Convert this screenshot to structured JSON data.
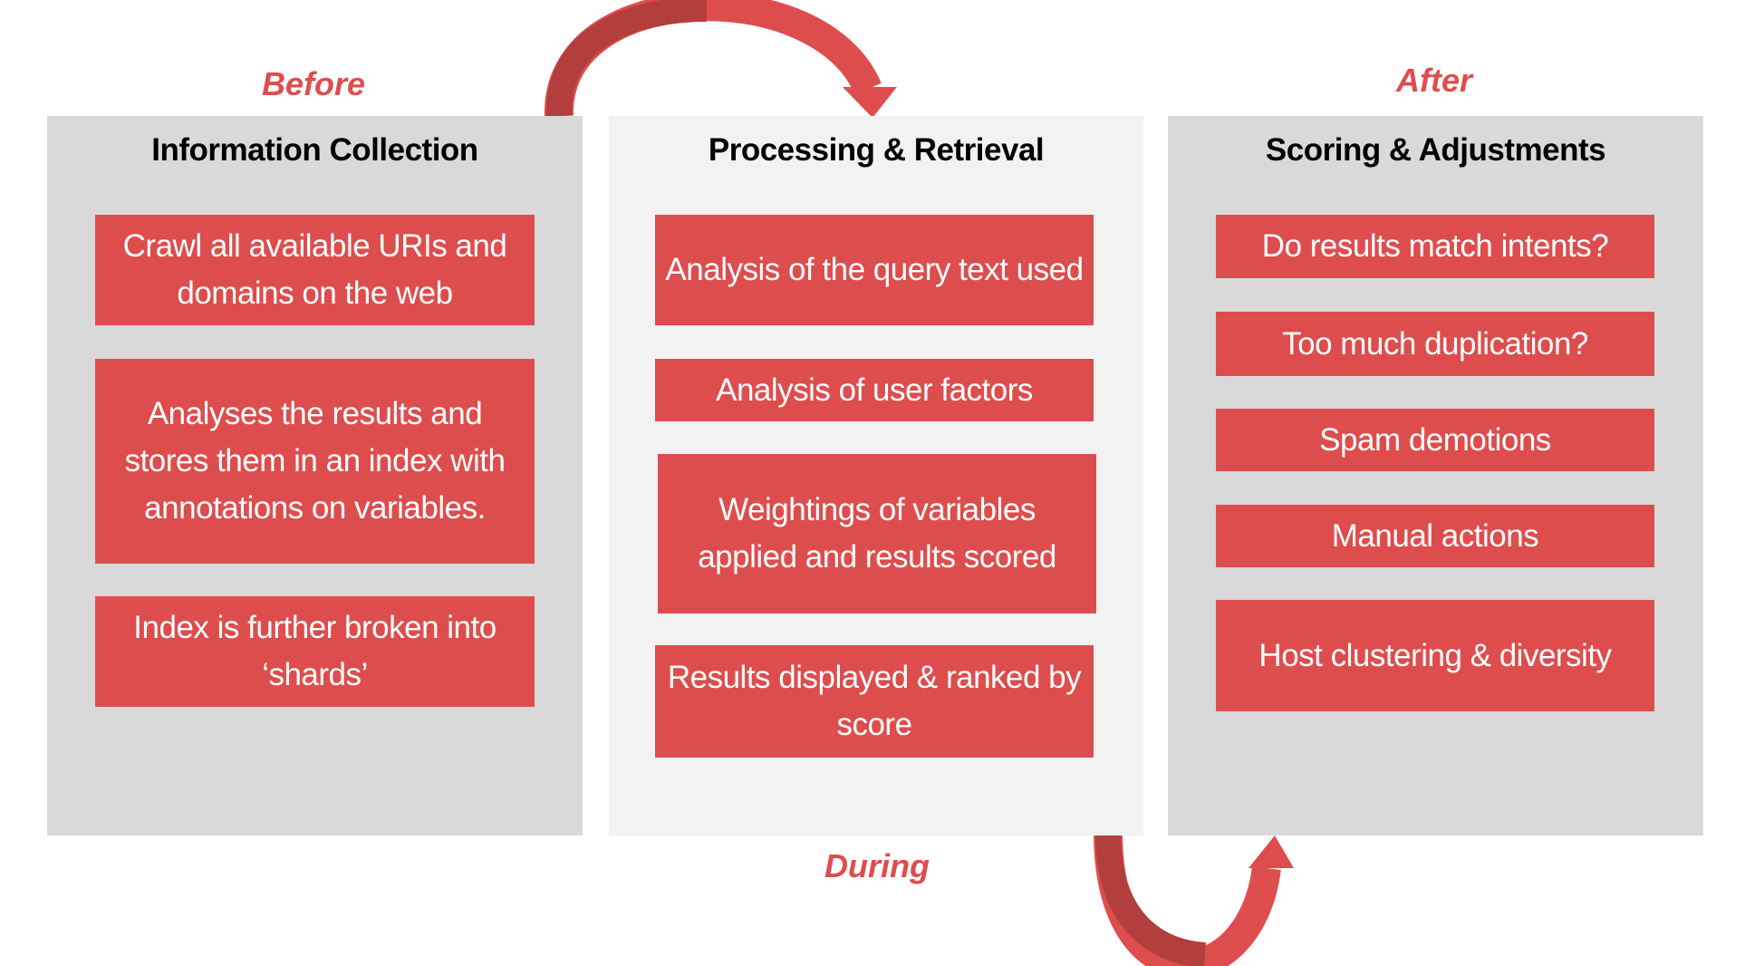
{
  "phases": {
    "before": "Before",
    "during": "During",
    "after": "After"
  },
  "colors": {
    "accent": "#de4d4d",
    "panel_dark": "#d9d9d9",
    "panel_light": "#f2f2f2"
  },
  "columns": [
    {
      "title": "Information Collection",
      "items": [
        "Crawl all available URIs and domains on the web",
        "Analyses the results and stores them in an index with annotations on variables.",
        "Index is further broken into ‘shards’"
      ]
    },
    {
      "title": "Processing & Retrieval",
      "items": [
        "Analysis of the query text used",
        "Analysis of user factors",
        "Weightings of variables applied and results scored",
        "Results displayed & ranked by score"
      ]
    },
    {
      "title": "Scoring & Adjustments",
      "items": [
        "Do results match intents?",
        "Too much duplication?",
        "Spam demotions",
        "Manual actions",
        "Host clustering & diversity"
      ]
    }
  ]
}
